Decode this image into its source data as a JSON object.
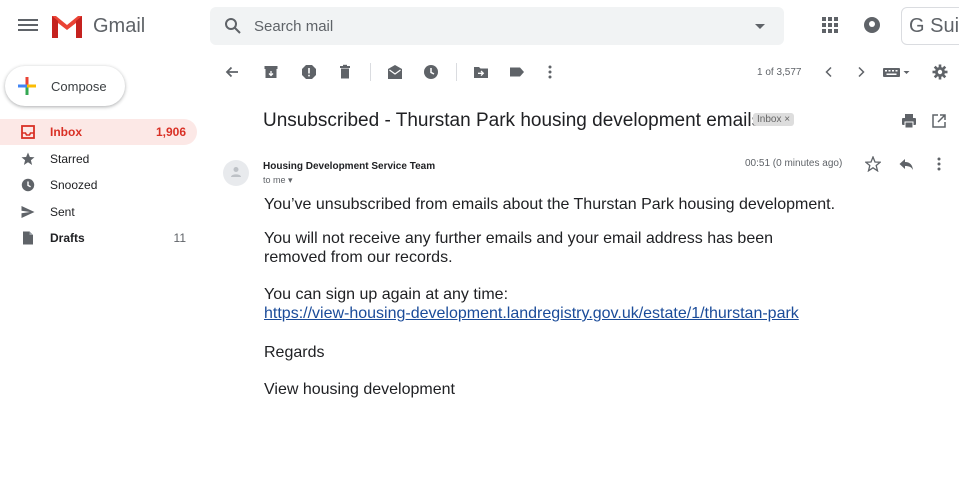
{
  "app": {
    "name": "Gmail"
  },
  "search": {
    "placeholder": "Search mail"
  },
  "header": {
    "suite_label": "G Suit"
  },
  "sidebar": {
    "compose_label": "Compose",
    "items": [
      {
        "label": "Inbox",
        "count": "1,906"
      },
      {
        "label": "Starred",
        "count": ""
      },
      {
        "label": "Snoozed",
        "count": ""
      },
      {
        "label": "Sent",
        "count": ""
      },
      {
        "label": "Drafts",
        "count": "11"
      }
    ]
  },
  "toolbar": {
    "pager": "1 of 3,577"
  },
  "email": {
    "subject": "Unsubscribed - Thurstan Park housing development emails",
    "label_tag": "Inbox ×",
    "sender": "Housing Development Service Team",
    "to": "to me ▾",
    "time": "00:51 (0 minutes ago)",
    "paragraphs": [
      "You’ve unsubscribed from emails about the Thurstan Park housing development.",
      "You will not receive any further emails and your email address has been removed from our records.",
      "You can sign up again at any time:"
    ],
    "link": "https://view-housing-development.landregistry.gov.uk/estate/1/thurstan-park",
    "regards": "Regards",
    "footer_link": "View housing development"
  },
  "colors": {
    "accent_red": "#d93025",
    "active_bg": "#fce8e6",
    "link": "#1a4b99"
  }
}
